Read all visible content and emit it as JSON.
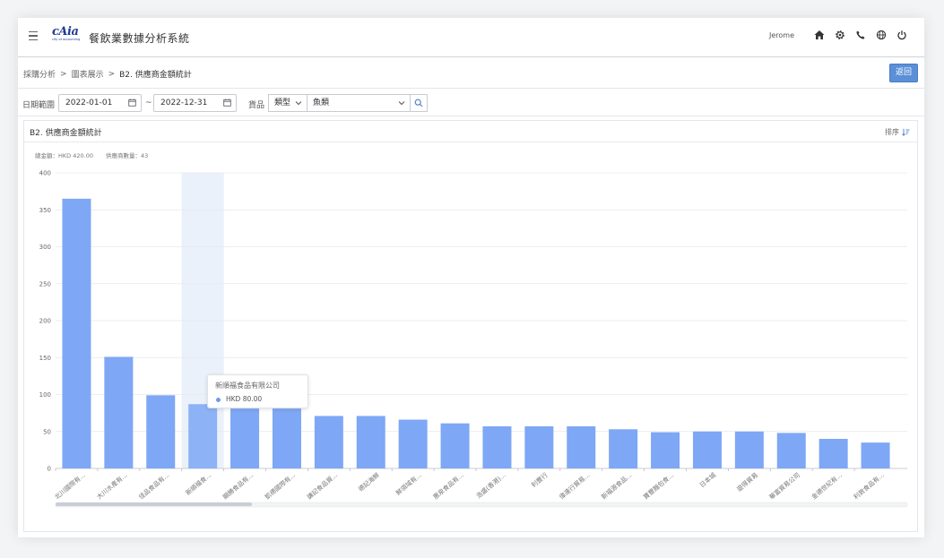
{
  "header": {
    "logo_text": "cAia",
    "logo_sub": "city of accounting",
    "title": "餐飲業數據分析系統",
    "user": "Jerome",
    "icons": [
      "home-icon",
      "settings-icon",
      "phone-icon",
      "globe-icon",
      "power-icon"
    ]
  },
  "breadcrumb": {
    "items": [
      "採購分析",
      "圖表展示",
      "B2. 供應商金額統計"
    ],
    "separator": ">"
  },
  "back_button": "返回",
  "filters": {
    "date_label": "日期範圍",
    "start_date": "2022-01-01",
    "end_date": "2022-12-31",
    "tilde": "~",
    "goods_label": "貨品",
    "category_type": "類型",
    "category_value": "魚類"
  },
  "panel": {
    "title": "B2. 供應商金額統計",
    "sort_label": "排序",
    "total_amount": "總金額：HKD 420.00",
    "supplier_count": "供應商數量：43"
  },
  "tooltip": {
    "title": "新順福食品有限公司",
    "value": "HKD 80.00"
  },
  "chart_data": {
    "type": "bar",
    "categories": [
      "北川國際有...",
      "大川水產有...",
      "佳品食品有...",
      "新順福食...",
      "顯勝食品有...",
      "凱德國際有...",
      "謙記食品貿...",
      "德記海鮮",
      "鮮領域有...",
      "惠泉食品有...",
      "浩盛(香港)...",
      "利豐行",
      "偉達行貿易...",
      "新福源食品...",
      "寶豐麵包食...",
      "日本城",
      "遊得貿易",
      "華富貿易公司",
      "金德世紀有...",
      "利敦食品有..."
    ],
    "values": [
      365,
      151,
      99,
      87,
      81,
      81,
      71,
      71,
      66,
      61,
      57,
      57,
      57,
      53,
      49,
      50,
      50,
      48,
      40,
      35
    ],
    "ylim": [
      0,
      400
    ],
    "yticks": [
      "0",
      "50",
      "100",
      "150",
      "200",
      "250",
      "300",
      "350",
      "400"
    ],
    "highlight_index": 3,
    "bar_color": "#7ea7f5",
    "grid": true
  }
}
